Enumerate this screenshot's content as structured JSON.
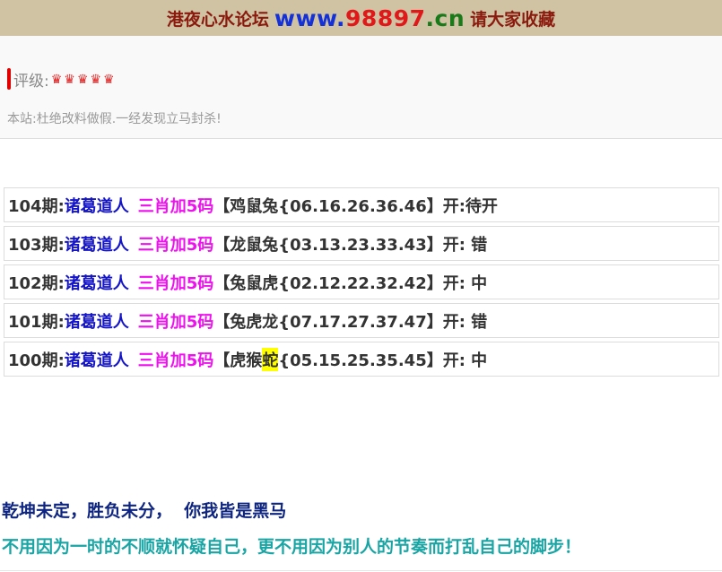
{
  "banner": {
    "text_left": "港夜心水论坛",
    "url_www": "www.",
    "url_num": "98897",
    "url_tld": ".cn",
    "text_right": "请大家收藏"
  },
  "info": {
    "rating_label": "评级:",
    "rating_stars": 5,
    "crown_glyph": "♛",
    "notice": "本站:杜绝改料做假.一经发现立马封杀!"
  },
  "records": [
    {
      "period": "104期:",
      "name": "诸葛道人",
      "tag": "三肖加5码",
      "pre": "【鸡鼠兔{06.16.26.36.46】开:待开",
      "hl": "",
      "post": ""
    },
    {
      "period": "103期:",
      "name": "诸葛道人",
      "tag": "三肖加5码",
      "pre": "【龙鼠兔{03.13.23.33.43】开: 错",
      "hl": "",
      "post": ""
    },
    {
      "period": "102期:",
      "name": "诸葛道人",
      "tag": "三肖加5码",
      "pre": "【兔鼠虎{02.12.22.32.42】开: 中",
      "hl": "",
      "post": ""
    },
    {
      "period": "101期:",
      "name": "诸葛道人",
      "tag": "三肖加5码",
      "pre": "【兔虎龙{07.17.27.37.47】开: 错",
      "hl": "",
      "post": ""
    },
    {
      "period": "100期:",
      "name": "诸葛道人",
      "tag": "三肖加5码",
      "pre": "【虎猴",
      "hl": "蛇",
      "post": "{05.15.25.35.45】开: 中"
    }
  ],
  "slogans": {
    "line1": "乾坤未定，胜负未分，  你我皆是黑马",
    "line2": "不用因为一时的不顺就怀疑自己，更不用因为别人的节奏而打乱自己的脚步！"
  },
  "colors": {
    "banner_bg": "#cfc3a4",
    "name_blue": "#1414c8",
    "tag_magenta": "#ee10ee",
    "highlight": "#ffff00",
    "slogan_navy": "#0d2480",
    "slogan_teal": "#1aa5a5"
  }
}
